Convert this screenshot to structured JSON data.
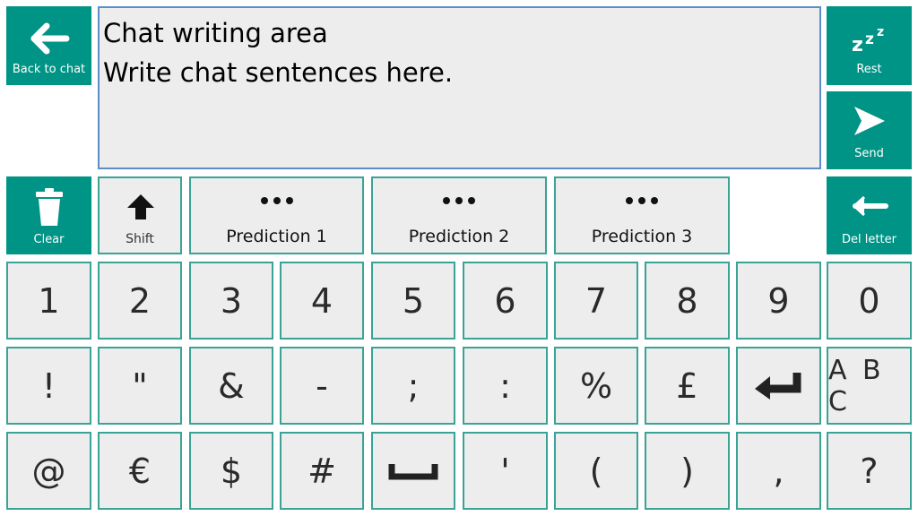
{
  "left_panel": {
    "back_label": "Back to chat",
    "clear_label": "Clear"
  },
  "right_panel": {
    "rest_label": "Rest",
    "send_label": "Send",
    "del_label": "Del letter"
  },
  "writing_area": {
    "line1": "Chat writing area",
    "line2": "Write chat sentences here."
  },
  "shift_label": "Shift",
  "predictions": [
    "Prediction 1",
    "Prediction 2",
    "Prediction 3"
  ],
  "keys": {
    "row1": [
      "1",
      "2",
      "3",
      "4",
      "5",
      "6",
      "7",
      "8",
      "9",
      "0"
    ],
    "row2": [
      "!",
      "\"",
      "&",
      "-",
      ";",
      ":",
      "%",
      "£",
      "enter-icon",
      "A B C"
    ],
    "row3": [
      "@",
      "€",
      "$",
      "#",
      "space-icon",
      "'",
      "(",
      ")",
      ",",
      "?"
    ]
  },
  "colors": {
    "accent": "#009486",
    "key_border": "#3aa396",
    "key_bg": "#ededed",
    "text_area_border": "#5b8ec9"
  }
}
